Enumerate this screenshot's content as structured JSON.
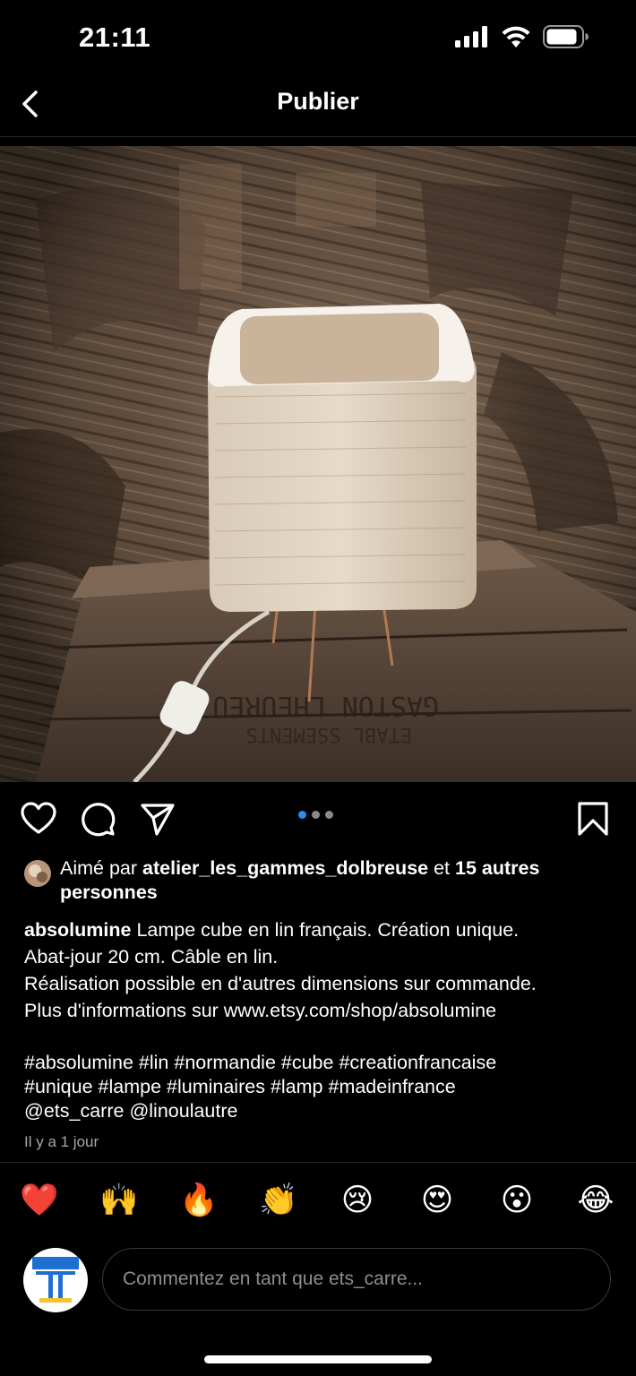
{
  "status": {
    "time": "21:11"
  },
  "nav": {
    "title": "Publier"
  },
  "post": {
    "carousel": {
      "total": 3,
      "active": 1
    },
    "likes": {
      "prefix": "Aimé par ",
      "user": "atelier_les_gammes_dolbreuse",
      "mid": " et ",
      "others": "15 autres personnes"
    },
    "caption": {
      "username": "absolumine",
      "text": " Lampe cube en lin français. Création unique.\nAbat-jour 20 cm. Câble en lin.\nRéalisation possible en d'autres dimensions sur commande.\nPlus d'informations sur www.etsy.com/shop/absolumine"
    },
    "tags": [
      "#absolumine",
      "#lin",
      "#normandie",
      "#cube",
      "#creationfrancaise",
      "#unique",
      "#lampe",
      "#luminaires",
      "#lamp",
      "#madeinfrance",
      "@ets_carre",
      "@linoulautre"
    ],
    "timestamp": "Il y a 1 jour"
  },
  "reactions": [
    "❤️",
    "🙌",
    "🔥",
    "👏",
    "😢",
    "😍",
    "😮",
    "😂"
  ],
  "comment": {
    "placeholder": "Commentez en tant que ets_carre..."
  },
  "icons": {
    "back": "chevron-left-icon",
    "like": "heart-icon",
    "comment": "comment-icon",
    "share": "paper-plane-icon",
    "save": "bookmark-icon"
  }
}
